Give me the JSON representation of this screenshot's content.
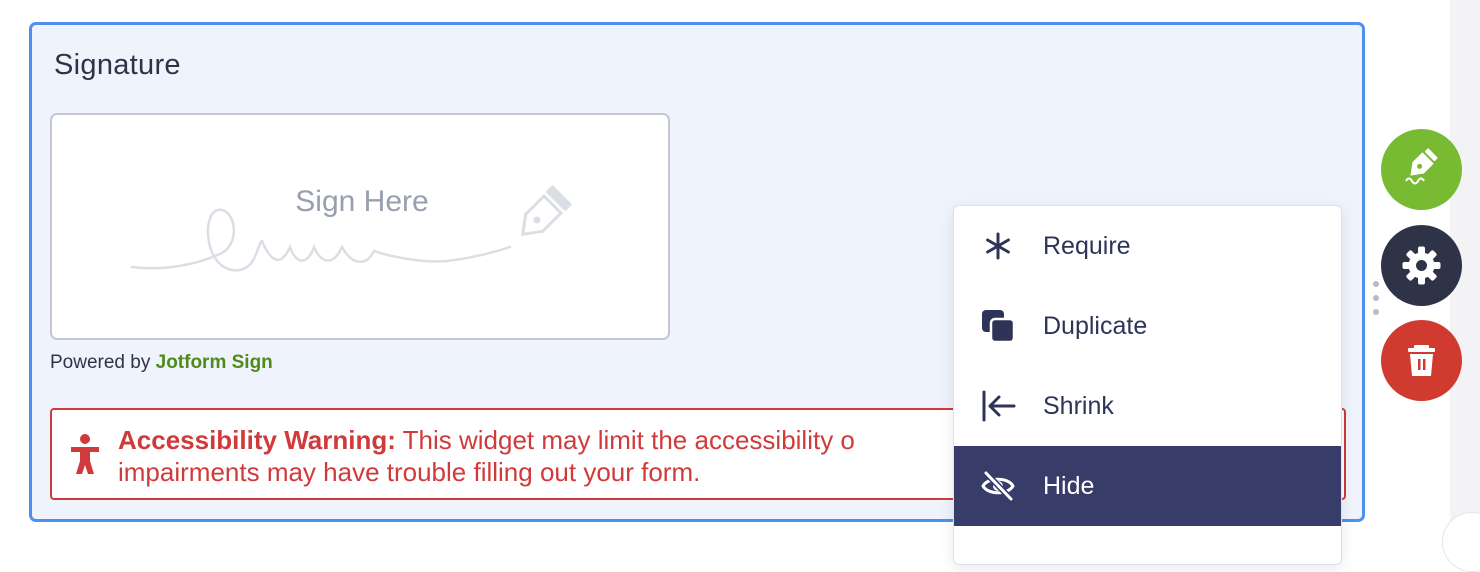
{
  "field": {
    "title": "Signature",
    "sign_placeholder": "Sign Here",
    "powered_prefix": "Powered by ",
    "powered_brand": "Jotform Sign"
  },
  "warning": {
    "title": "Accessibility Warning:",
    "line1": " This widget may limit the accessibility o",
    "line2": "impairments may have trouble filling out your form."
  },
  "menu": {
    "items": [
      {
        "label": "Require",
        "icon": "asterisk-icon"
      },
      {
        "label": "Duplicate",
        "icon": "duplicate-icon"
      },
      {
        "label": "Shrink",
        "icon": "shrink-icon"
      },
      {
        "label": "Hide",
        "icon": "eye-off-icon",
        "active": true
      }
    ]
  },
  "toolbar": {
    "buttons": [
      {
        "name": "signature-settings",
        "icon": "pen-nib-icon",
        "color": "#78bb33"
      },
      {
        "name": "properties",
        "icon": "gear-icon",
        "color": "#2f3348"
      },
      {
        "name": "delete",
        "icon": "trash-icon",
        "color": "#d03a2f"
      }
    ]
  },
  "colors": {
    "card_border": "#4e90ef",
    "card_bg": "#eff3fc",
    "warning": "#d03a3a",
    "brand_green": "#4f8a1b",
    "menu_active": "#383c68"
  }
}
